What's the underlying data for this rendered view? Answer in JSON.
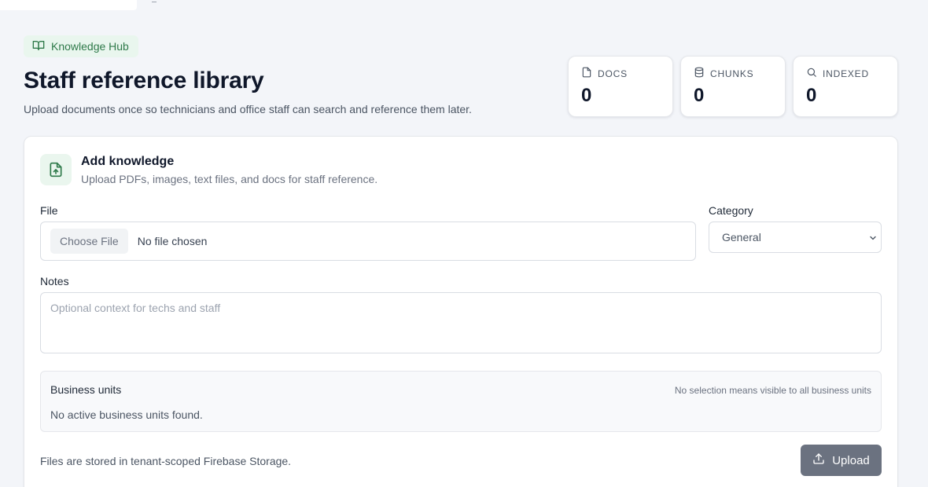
{
  "header": {
    "badge_label": "Knowledge Hub",
    "title": "Staff reference library",
    "subtitle": "Upload documents once so technicians and office staff can search and reference them later."
  },
  "stats": [
    {
      "label": "DOCS",
      "value": "0",
      "icon": "file-icon"
    },
    {
      "label": "CHUNKS",
      "value": "0",
      "icon": "database-icon"
    },
    {
      "label": "INDEXED",
      "value": "0",
      "icon": "search-icon"
    }
  ],
  "form": {
    "title": "Add knowledge",
    "subtitle": "Upload PDFs, images, text files, and docs for staff reference.",
    "file_label": "File",
    "file_button": "Choose File",
    "file_status": "No file chosen",
    "category_label": "Category",
    "category_value": "General",
    "notes_label": "Notes",
    "notes_placeholder": "Optional context for techs and staff",
    "business_units_title": "Business units",
    "business_units_hint": "No selection means visible to all business units",
    "business_units_empty": "No active business units found.",
    "footnote": "Files are stored in tenant-scoped Firebase Storage.",
    "upload_label": "Upload"
  },
  "colors": {
    "accent_green": "#2f7a4a",
    "badge_bg": "#e9f6ee",
    "button_gray": "#6b7280",
    "page_bg": "#f3f5f9"
  }
}
